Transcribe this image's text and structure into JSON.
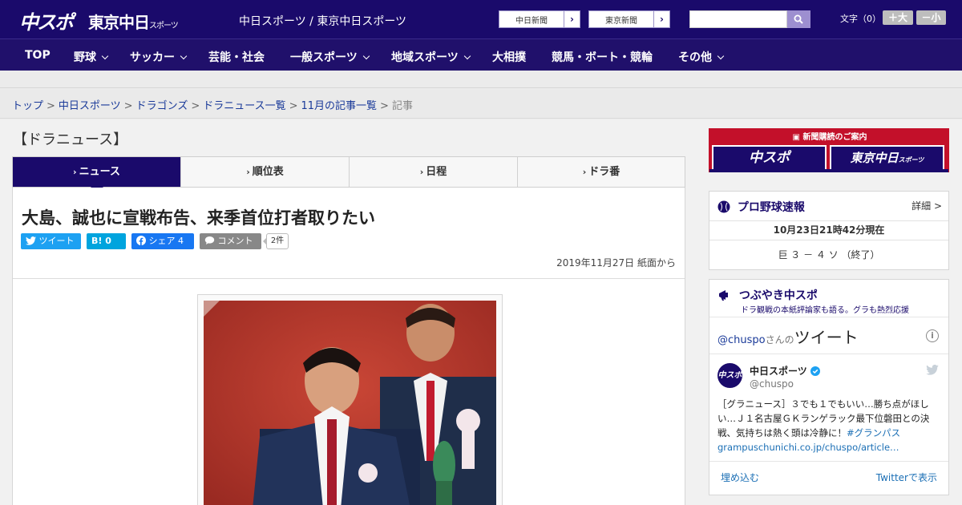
{
  "header": {
    "logo_main": "中スポ",
    "logo_tokyo": "東京中日",
    "logo_tokyo_sub": "スポーツ",
    "site_names": "中日スポーツ / 東京中日スポーツ",
    "paper_links": [
      "中日新聞",
      "東京新聞"
    ],
    "search_placeholder": "",
    "font_size_label": "文字（0）",
    "font_bigger": "＋大",
    "font_smaller": "－小"
  },
  "nav": [
    {
      "label": "TOP",
      "dropdown": false
    },
    {
      "label": "野球",
      "dropdown": true
    },
    {
      "label": "サッカー",
      "dropdown": true
    },
    {
      "label": "芸能・社会",
      "dropdown": false
    },
    {
      "label": "一般スポーツ",
      "dropdown": true
    },
    {
      "label": "地域スポーツ",
      "dropdown": true
    },
    {
      "label": "大相撲",
      "dropdown": false
    },
    {
      "label": "競馬・ボート・競輪",
      "dropdown": false
    },
    {
      "label": "その他",
      "dropdown": true
    }
  ],
  "breadcrumb": {
    "links": [
      "トップ",
      "中日スポーツ",
      "ドラゴンズ",
      "ドラニュース一覧",
      "11月の記事一覧"
    ],
    "current": "記事",
    "separator": ">"
  },
  "section_title": "【ドラニュース】",
  "tabs": [
    "ニュース",
    "順位表",
    "日程",
    "ドラ番"
  ],
  "article": {
    "headline": "大島、誠也に宣戦布告、来季首位打者取りたい",
    "share": {
      "tweet": "ツイート",
      "hatena_label": "B!",
      "hatena_count": "0",
      "facebook": "シェア",
      "facebook_count": "4",
      "comment": "コメント",
      "comment_count": "2件"
    },
    "date": "2019年11月27日 紙面から"
  },
  "sidebar": {
    "subscribe_caption": "新聞購読のご案内",
    "subscribe_buttons": [
      "中スポ",
      "東京中日"
    ],
    "subscribe_tokyo_sub": "スポーツ",
    "baseball": {
      "title": "プロ野球速報",
      "detail": "詳細 >",
      "time": "10月23日21時42分現在",
      "score": "巨 ３ － ４ ソ （終了）"
    },
    "tsubuyaki": {
      "title": "つぶやき中スポ",
      "subtitle": "ドラ観戦の本紙評論家も語る。グラも熱烈応援",
      "tweets_handle": "@chuspo",
      "tweets_san": "さんの",
      "tweets_word": "ツイート",
      "account_name": "中日スポーツ",
      "account_handle": "@chuspo",
      "avatar_text": "中スポ",
      "tweet_text": "［グラニュース］３でも１でもいい…勝ち点がほしい…Ｊ１名古屋ＧＫランゲラック最下位磐田との決戦、気持ちは熱く頭は冷静に！",
      "hashtag": "#グランパス",
      "link": "grampuschunichi.co.jp/chuspo/article…",
      "embed": "埋め込む",
      "view_on_twitter": "Twitterで表示"
    }
  },
  "colors": {
    "brand_navy": "#1a0a6b",
    "nav_bg": "#20106b",
    "twitter": "#1da1f2",
    "hatena": "#00a4de",
    "facebook": "#1877f2",
    "comment": "#888888",
    "subscribe_red": "#c3102a",
    "photo_bg": "#b8362c"
  }
}
